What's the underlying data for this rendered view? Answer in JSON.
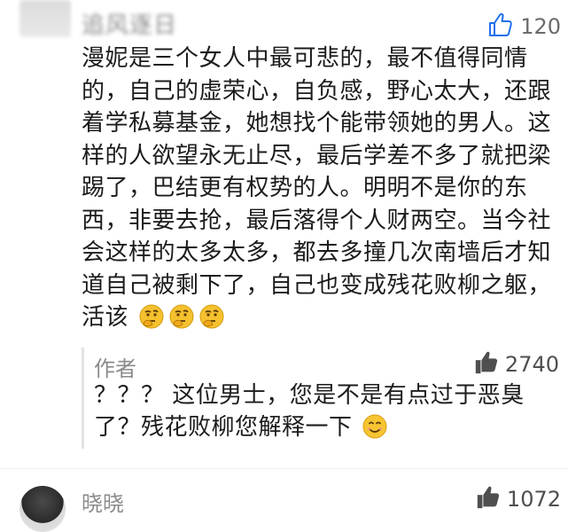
{
  "top_comment": {
    "username": "追风逐日",
    "like_count": "120",
    "text": "漫妮是三个女人中最可悲的，最不值得同情的，自己的虚荣心，自负感，野心太大，还跟着学私募基金，她想找个能带领她的男人。这样的人欲望永无止尽，最后学差不多了就把梁踢了，巴结更有权势的人。明明不是你的东西，非要去抢，最后落得个人财两空。当今社会这样的太多太多，都去多撞几次南墙后才知道自己被剩下了，自己也变成残花败柳之躯，活该",
    "emoji_names": [
      "thinking-emoji",
      "thinking-emoji",
      "thinking-emoji"
    ]
  },
  "author_reply": {
    "author_label": "作者",
    "like_count": "2740",
    "text": "？？？ 这位男士，您是不是有点过于恶臭了？残花败柳您解释一下",
    "emoji_name": "smile-emoji"
  },
  "next_comment": {
    "username": "晓晓",
    "like_count": "1072"
  },
  "colors": {
    "like_outline": "#1f6feb",
    "like_filled": "#4f4f4f",
    "text": "#1c1c1c",
    "muted": "#8b8b8b"
  }
}
